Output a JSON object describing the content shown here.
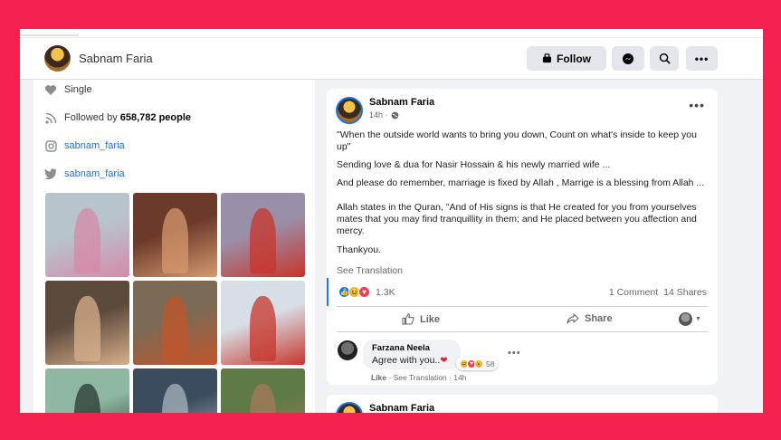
{
  "profile": {
    "name": "Sabnam Faria"
  },
  "header": {
    "follow_label": "Follow"
  },
  "intro": {
    "relationship": "Single",
    "followed_prefix": "Followed by",
    "followed_count": "658,782 people",
    "instagram": "sabnam_faria",
    "twitter": "sabnam_faria"
  },
  "photos": [
    {
      "colors": [
        "#b7c4cc",
        "#d58aa8"
      ]
    },
    {
      "colors": [
        "#6b3a2a",
        "#d69a6e"
      ]
    },
    {
      "colors": [
        "#9a8fa8",
        "#c8342b"
      ]
    },
    {
      "colors": [
        "#5c4a3c",
        "#d8b08c"
      ]
    },
    {
      "colors": [
        "#7b6a55",
        "#c2552b"
      ]
    },
    {
      "colors": [
        "#d8dee6",
        "#c7362b"
      ]
    },
    {
      "colors": [
        "#8fb8a2",
        "#263a2f"
      ]
    },
    {
      "colors": [
        "#3b4c5e",
        "#aab4bf"
      ]
    },
    {
      "colors": [
        "#5e7a46",
        "#a87a5a"
      ]
    }
  ],
  "post": {
    "author": "Sabnam Faria",
    "time": "14h ·",
    "paragraphs": [
      "\"When the outside world wants to bring you down, Count on what's inside to keep you up\"",
      "Sending love & dua for Nasir Hossain & his newly married wife ...",
      "And please do remember, marriage is fixed by Allah , Marrige is a blessing from Allah ...",
      "Allah states in the Quran, \"And of His signs is that He created for you from yourselves mates that you may find tranquillity in them; and He placed between you affection and mercy.",
      "Thankyou."
    ],
    "see_translation": "See Translation",
    "reaction_count": "1.3K",
    "comments": "1 Comment",
    "shares": "14 Shares",
    "like_label": "Like",
    "share_label": "Share"
  },
  "comment": {
    "author": "Farzana Neela",
    "text": "Agree with you..",
    "reaction_count": "58",
    "like": "Like",
    "see_translation": "See Translation",
    "time": "14h"
  },
  "next_post": {
    "author": "Sabnam Faria"
  },
  "colors": {
    "background": "#f5214f",
    "accent": "#1877f2",
    "link": "#216fdb"
  }
}
